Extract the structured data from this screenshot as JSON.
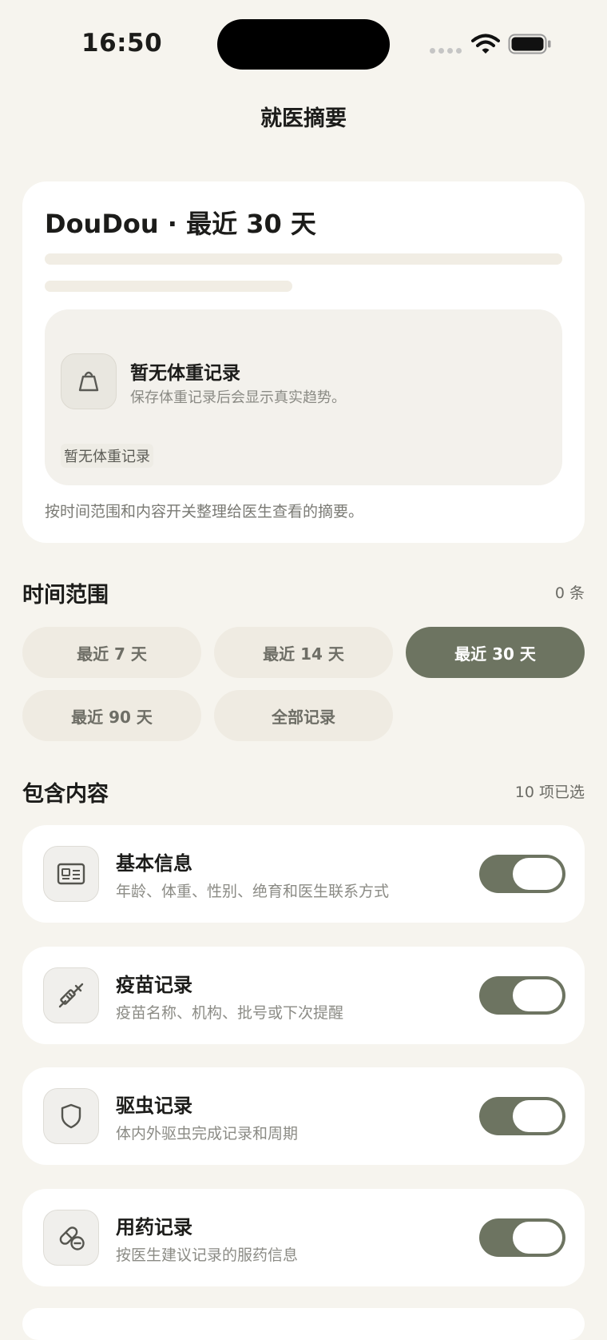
{
  "status_bar": {
    "time": "16:50"
  },
  "header": {
    "title": "就医摘要"
  },
  "summary": {
    "title": "DouDou · 最近 30 天",
    "weight_empty": {
      "icon": "scale-icon",
      "title": "暂无体重记录",
      "subtitle": "保存体重记录后会显示真实趋势。",
      "tag": "暂无体重记录"
    },
    "description": "按时间范围和内容开关整理给医生查看的摘要。"
  },
  "time_range": {
    "title": "时间范围",
    "count": "0 条",
    "options": [
      {
        "label": "最近 7 天",
        "selected": false
      },
      {
        "label": "最近 14 天",
        "selected": false
      },
      {
        "label": "最近 30 天",
        "selected": true
      },
      {
        "label": "最近 90 天",
        "selected": false
      },
      {
        "label": "全部记录",
        "selected": false
      }
    ]
  },
  "contents": {
    "title": "包含内容",
    "selected_count": "10 项已选",
    "items": [
      {
        "icon": "id-card-icon",
        "title": "基本信息",
        "desc": "年龄、体重、性别、绝育和医生联系方式",
        "enabled": true
      },
      {
        "icon": "syringe-icon",
        "title": "疫苗记录",
        "desc": "疫苗名称、机构、批号或下次提醒",
        "enabled": true
      },
      {
        "icon": "shield-icon",
        "title": "驱虫记录",
        "desc": "体内外驱虫完成记录和周期",
        "enabled": true
      },
      {
        "icon": "pill-icon",
        "title": "用药记录",
        "desc": "按医生建议记录的服药信息",
        "enabled": true
      }
    ]
  },
  "colors": {
    "accent": "#6d7461",
    "background": "#f6f4ee",
    "card": "#ffffff",
    "chip": "#efebe2"
  }
}
